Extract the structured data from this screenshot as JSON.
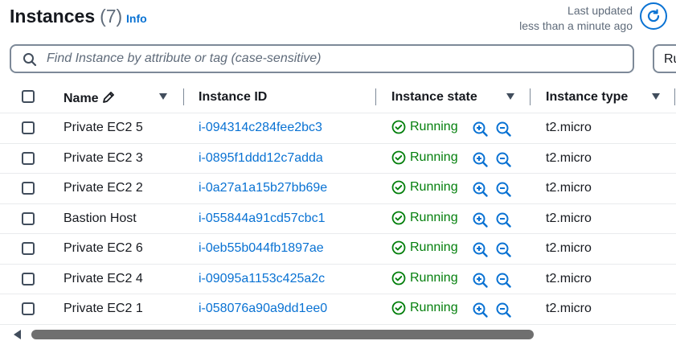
{
  "header": {
    "title": "Instances",
    "count": "(7)",
    "info_label": "Info",
    "last_updated_label": "Last updated",
    "last_updated_value": "less than a minute ago"
  },
  "search": {
    "placeholder": "Find Instance by attribute or tag (case-sensitive)",
    "value": ""
  },
  "next_button_label": "Ru",
  "table": {
    "columns": [
      "Name",
      "Instance ID",
      "Instance state",
      "Instance type"
    ],
    "rows": [
      {
        "name": "Private EC2 5",
        "id": "i-094314c284fee2bc3",
        "state": "Running",
        "type": "t2.micro"
      },
      {
        "name": "Private EC2 3",
        "id": "i-0895f1ddd12c7adda",
        "state": "Running",
        "type": "t2.micro"
      },
      {
        "name": "Private EC2 2",
        "id": "i-0a27a1a15b27bb69e",
        "state": "Running",
        "type": "t2.micro"
      },
      {
        "name": "Bastion Host",
        "id": "i-055844a91cd57cbc1",
        "state": "Running",
        "type": "t2.micro"
      },
      {
        "name": "Private EC2 6",
        "id": "i-0eb55b044fb1897ae",
        "state": "Running",
        "type": "t2.micro"
      },
      {
        "name": "Private EC2 4",
        "id": "i-09095a1153c425a2c",
        "state": "Running",
        "type": "t2.micro"
      },
      {
        "name": "Private EC2 1",
        "id": "i-058076a90a9dd1ee0",
        "state": "Running",
        "type": "t2.micro"
      }
    ]
  },
  "colors": {
    "link": "#0972d3",
    "running": "#037f0c",
    "text": "#16191f",
    "muted": "#5f6b7a"
  },
  "icons": [
    "refresh-icon",
    "search-icon",
    "pencil-icon",
    "sort-caret-icon",
    "check-circle-icon",
    "zoom-in-icon",
    "zoom-out-icon"
  ]
}
